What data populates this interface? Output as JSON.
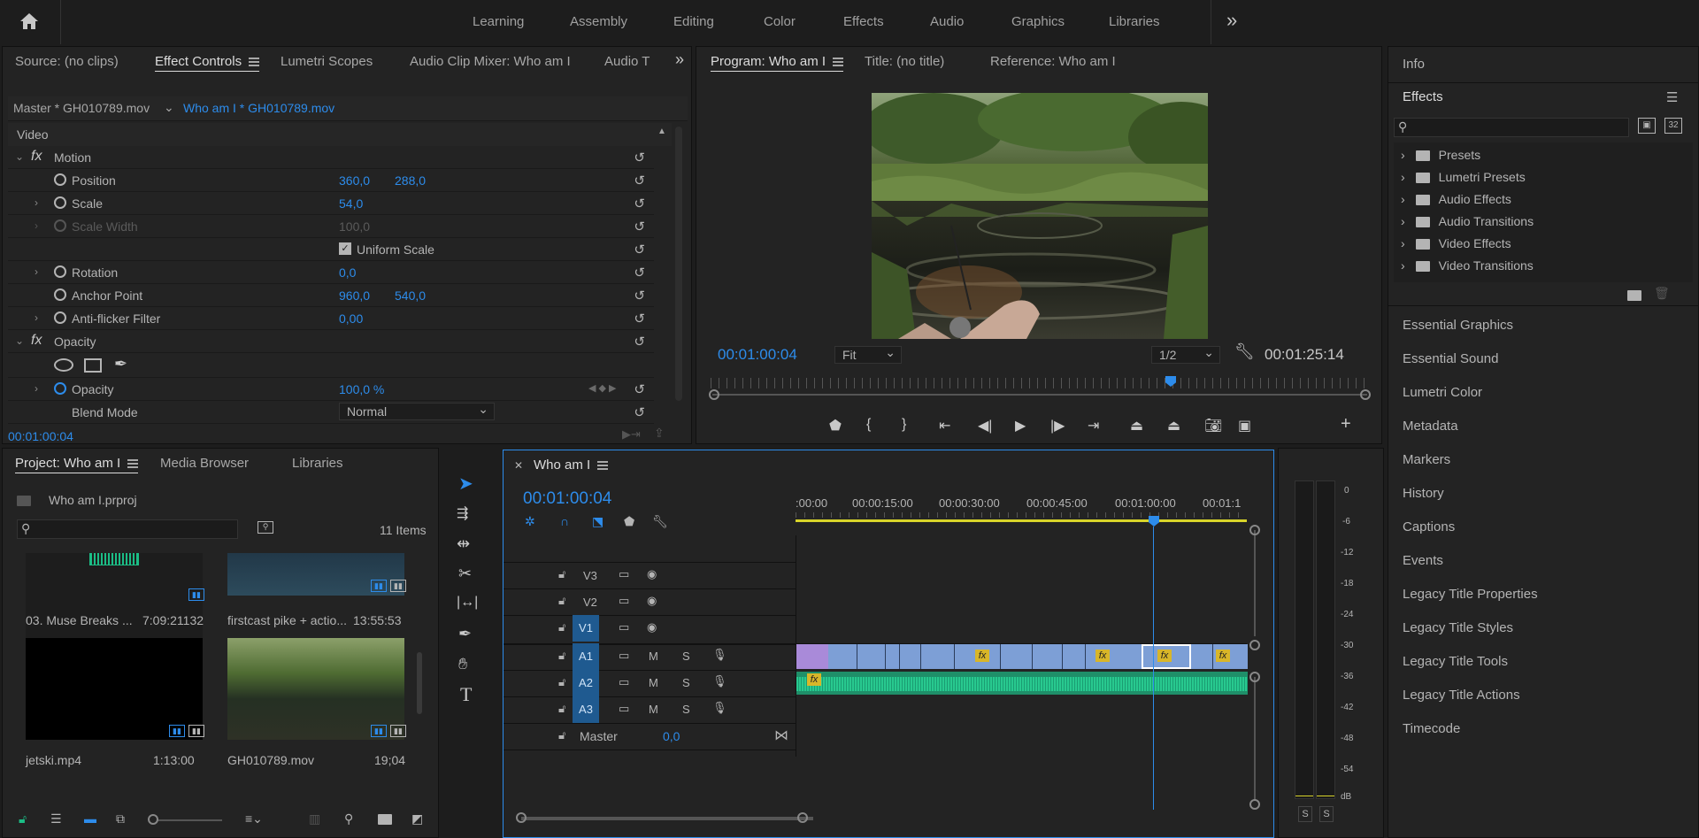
{
  "topbar": {
    "workspaces": [
      "Learning",
      "Assembly",
      "Editing",
      "Color",
      "Effects",
      "Audio",
      "Graphics",
      "Libraries"
    ],
    "more": "»"
  },
  "source_panel": {
    "tabs": [
      "Source: (no clips)",
      "Effect Controls",
      "Lumetri Scopes",
      "Audio Clip Mixer: Who am I",
      "Audio T"
    ],
    "master": "Master * GH010789.mov",
    "clip": "Who am I * GH010789.mov",
    "video_label": "Video",
    "motion": "Motion",
    "position": {
      "label": "Position",
      "x": "360,0",
      "y": "288,0"
    },
    "scale": {
      "label": "Scale",
      "v": "54,0"
    },
    "scale_width": {
      "label": "Scale Width",
      "v": "100,0"
    },
    "uniform_scale": "Uniform Scale",
    "rotation": {
      "label": "Rotation",
      "v": "0,0"
    },
    "anchor": {
      "label": "Anchor Point",
      "x": "960,0",
      "y": "540,0"
    },
    "antiflicker": {
      "label": "Anti-flicker Filter",
      "v": "0,00"
    },
    "opacity_group": "Opacity",
    "opacity": {
      "label": "Opacity",
      "v": "100,0 %"
    },
    "blend": {
      "label": "Blend Mode",
      "v": "Normal"
    },
    "timecode": "00:01:00:04"
  },
  "program": {
    "tabs": [
      "Program: Who am I",
      "Title: (no title)",
      "Reference: Who am I"
    ],
    "timecode": "00:01:00:04",
    "fit": "Fit",
    "resolution": "1/2",
    "duration": "00:01:25:14"
  },
  "right_panel": {
    "info": "Info",
    "effects": "Effects",
    "tree": [
      "Presets",
      "Lumetri Presets",
      "Audio Effects",
      "Audio Transitions",
      "Video Effects",
      "Video Transitions"
    ],
    "sections": [
      "Essential Graphics",
      "Essential Sound",
      "Lumetri Color",
      "Metadata",
      "Markers",
      "History",
      "Captions",
      "Events",
      "Legacy Title Properties",
      "Legacy Title Styles",
      "Legacy Title Tools",
      "Legacy Title Actions",
      "Timecode"
    ]
  },
  "project": {
    "tabs": [
      "Project: Who am I",
      "Media Browser",
      "Libraries"
    ],
    "file": "Who am I.prproj",
    "count": "11 Items",
    "items": [
      {
        "name": "03. Muse Breaks ...",
        "dur": "7:09:21132"
      },
      {
        "name": "firstcast pike + actio...",
        "dur": "13:55:53"
      },
      {
        "name": "jetski.mp4",
        "dur": "1:13:00"
      },
      {
        "name": "GH010789.mov",
        "dur": "19;04"
      }
    ]
  },
  "timeline": {
    "title": "Who am I",
    "timecode": "00:01:00:04",
    "ruler": [
      ":00:00",
      "00:00:15:00",
      "00:00:30:00",
      "00:00:45:00",
      "00:01:00:00",
      "00:01:1"
    ],
    "video_tracks": [
      "V3",
      "V2",
      "V1"
    ],
    "audio_tracks": [
      "A1",
      "A2",
      "A3"
    ],
    "master": "Master",
    "master_val": "0,0"
  },
  "meter": {
    "scale": [
      "0",
      "-6",
      "-12",
      "-18",
      "-24",
      "-30",
      "-36",
      "-42",
      "-48",
      "-54",
      "dB"
    ],
    "solo": [
      "S",
      "S"
    ]
  },
  "colors": {
    "accent": "#2d8ceb",
    "audio": "#1bbd86",
    "video_clip": "#7d9fd6",
    "fx": "#d8b629"
  }
}
